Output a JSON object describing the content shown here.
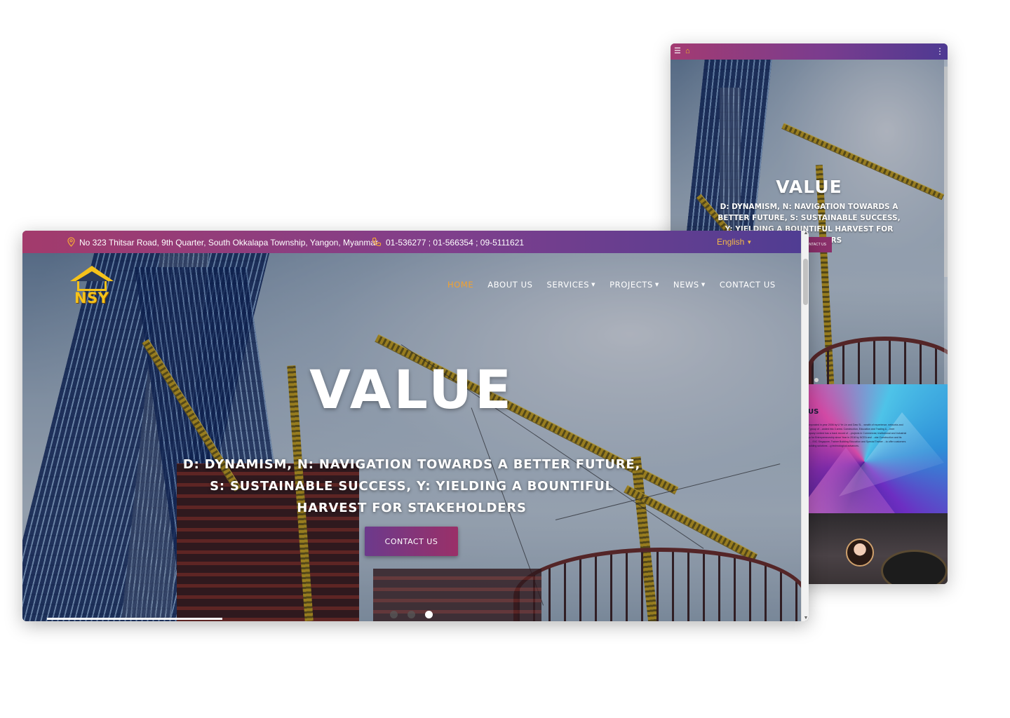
{
  "desktop": {
    "topbar": {
      "address_icon": "map-pin-icon",
      "address": "No 323 Thitsar Road, 9th Quarter, South Okkalapa Township, Yangon, Myanmar",
      "phone_icon": "phone-icon",
      "phones": "01-536277 ;  01-566354 ;  09-5111621",
      "language": "English"
    },
    "logo_text": "NSY",
    "nav": {
      "home": "HOME",
      "about": "ABOUT US",
      "services": "SERVICES",
      "projects": "PROJECTS",
      "news": "NEWS",
      "contact": "CONTACT US"
    },
    "hero": {
      "title": "VALUE",
      "subtitle": "D: DYNAMISM, N: NAVIGATION TOWARDS A BETTER FUTURE, S: SUSTAINABLE SUCCESS, Y: YIELDING A BOUNTIFUL HARVEST FOR STAKEHOLDERS",
      "button": "CONTACT US",
      "slides": 3,
      "active_slide": 3
    }
  },
  "mobile": {
    "menu_icon": "hamburger-icon",
    "more_icon": "kebab-menu-icon",
    "hero": {
      "title": "VALUE",
      "subtitle": "D: DYNAMISM, N: NAVIGATION TOWARDS A BETTER FUTURE, S: SUSTAINABLE SUCCESS, Y: YIELDING A BOUNTIFUL HARVEST FOR STAKEHOLDERS",
      "button": "CONTACT US"
    },
    "about": {
      "heading": "US",
      "paragraph": "...olution was incorporated in year 2006 by U Ye Lin and Daw Si... wealth of experience, networks and resources. DNSY group of ...anded into 3 arms: Construction, Education and Trading & ...ener Construction Company Limited has a track record of ...projects in Commercial, Institutional and Industrial fields. I... Buildings for Entrepreneurship since Year in 2018 by NCEA and ...olar Construction and its affiliated group of ... EIIC Singapore, Trainer Building Education and Special Trainer ...to offer customers an array of total building solutions ...g technological advances."
    }
  },
  "colors": {
    "topbar_start": "#a33b6c",
    "topbar_end": "#4f3d93",
    "nav_active": "#f2a12f",
    "accent_icon": "#f2a33a",
    "logo_yellow": "#f5c21a"
  }
}
